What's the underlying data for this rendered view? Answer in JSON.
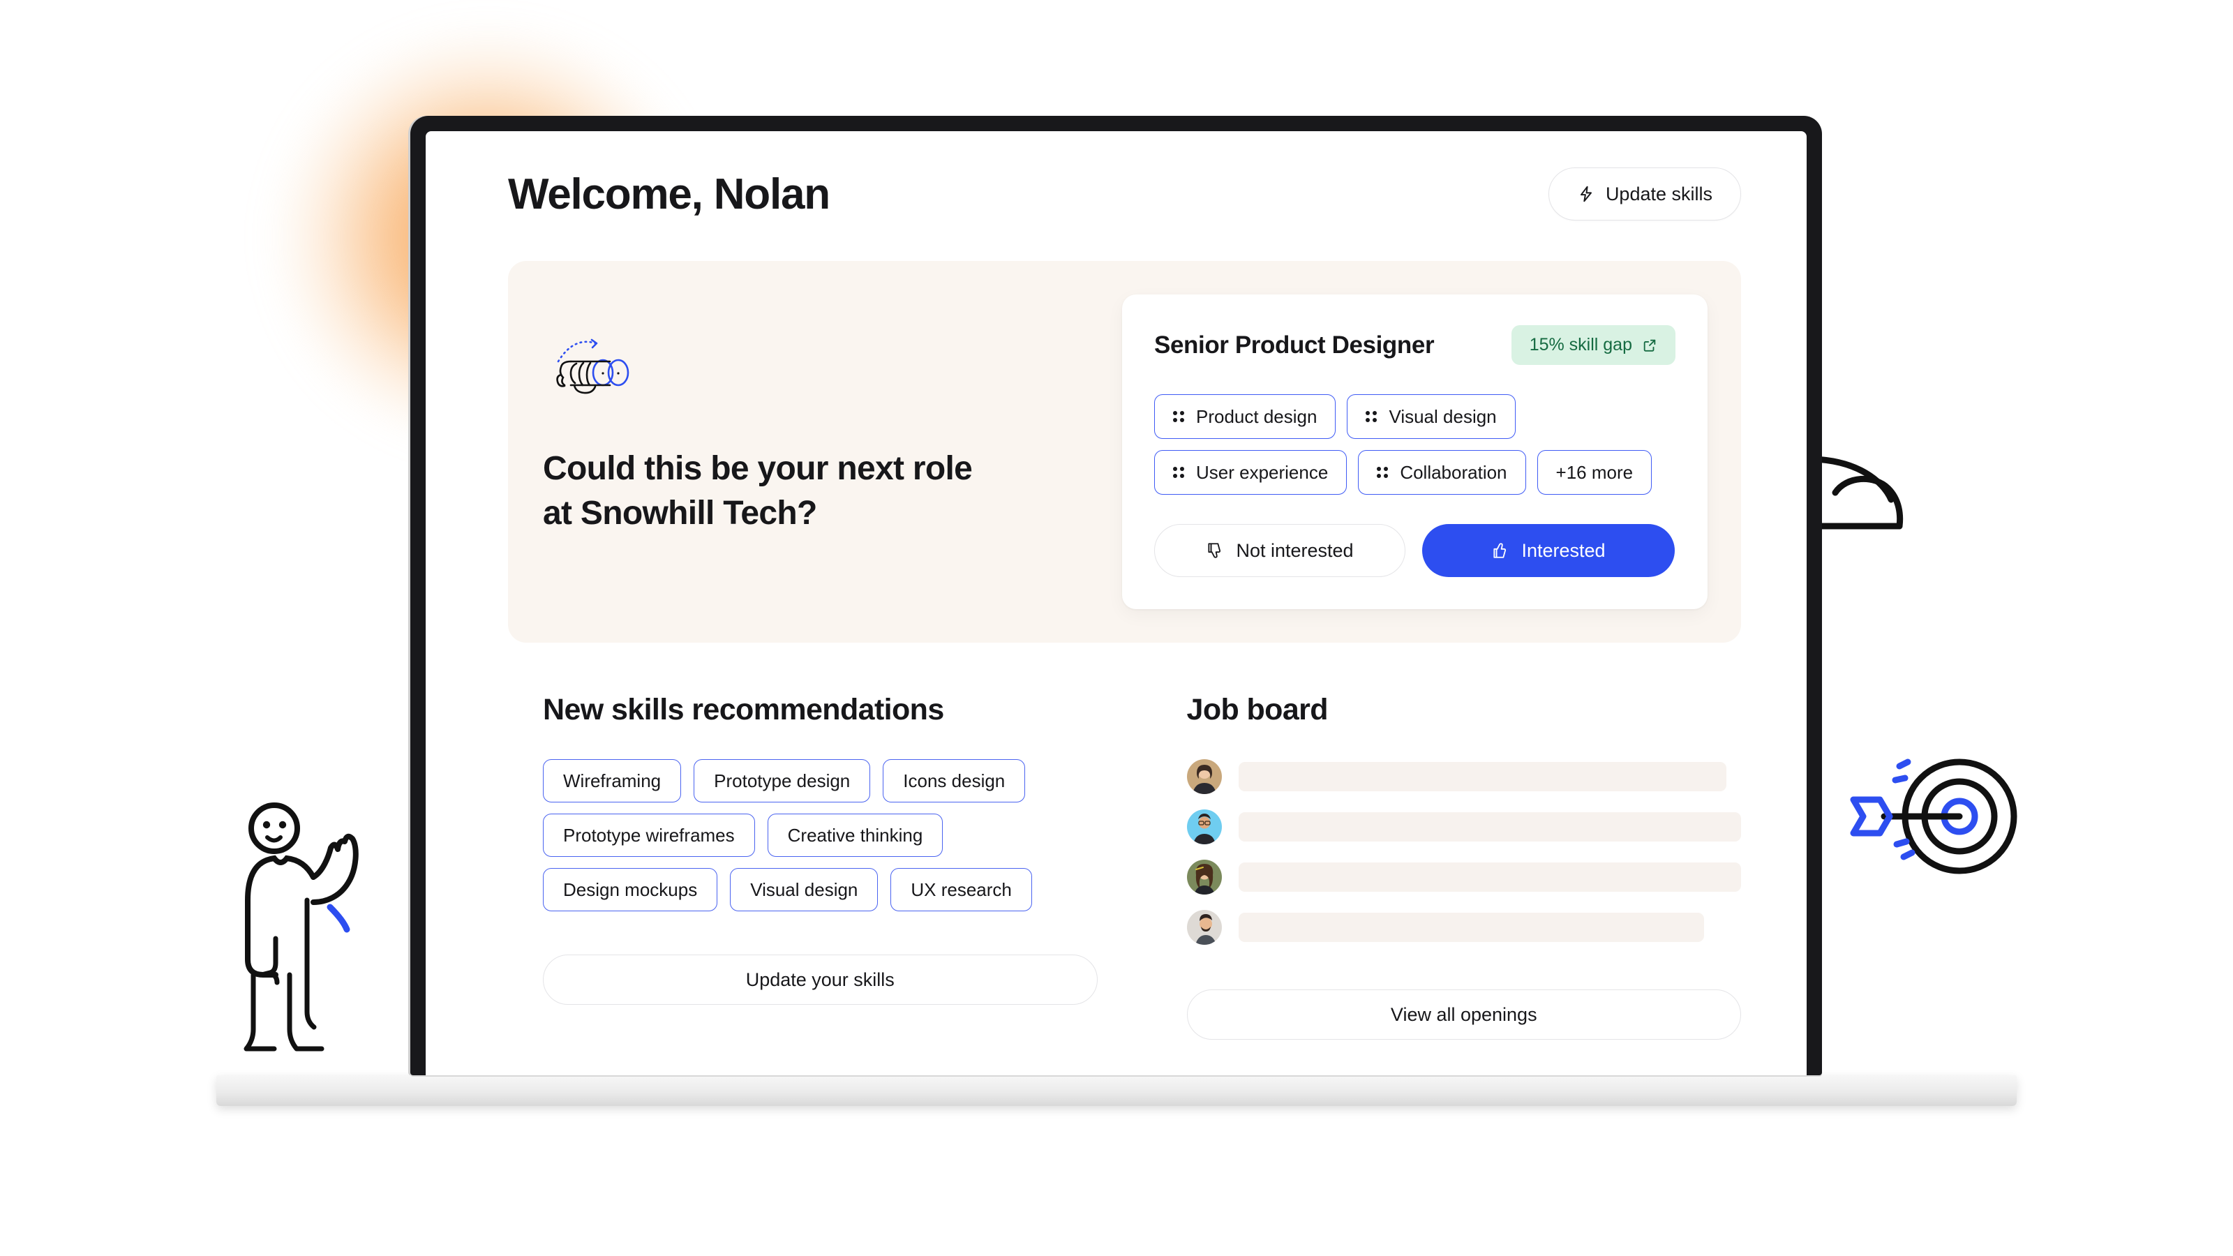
{
  "header": {
    "title": "Welcome, Nolan",
    "update_skills_label": "Update skills",
    "bolt_icon": "lightning-bolt-icon"
  },
  "hero": {
    "illustration": "binoculars-icon",
    "headline_line1": "Could this be your next role",
    "headline_line2": "at Snowhill Tech?",
    "headline": "Could this be your next role at Snowhill Tech?"
  },
  "role_card": {
    "title": "Senior Product Designer",
    "skill_gap_badge": "15% skill gap",
    "external_link_icon": "external-link-icon",
    "chips": [
      {
        "label": "Product design",
        "icon": "dots-grid-icon"
      },
      {
        "label": "Visual design",
        "icon": "dots-grid-icon"
      },
      {
        "label": "User experience",
        "icon": "dots-grid-icon"
      },
      {
        "label": "Collaboration",
        "icon": "dots-grid-icon"
      },
      {
        "label": "+16 more",
        "icon": ""
      }
    ],
    "not_interested_label": "Not interested",
    "interested_label": "Interested",
    "thumbs_down_icon": "thumbs-down-icon",
    "thumbs_up_icon": "thumbs-up-icon"
  },
  "recommendations": {
    "title": "New skills recommendations",
    "chips": [
      "Wireframing",
      "Prototype design",
      "Icons design",
      "Prototype wireframes",
      "Creative thinking",
      "Design mockups",
      "Visual design",
      "UX research"
    ],
    "cta_label": "Update your skills"
  },
  "job_board": {
    "title": "Job board",
    "rows": [
      {
        "avatar_color": "#c9a87c",
        "skeleton_width": "88%"
      },
      {
        "avatar_color": "#6fcdf0",
        "skeleton_width": "96%"
      },
      {
        "avatar_color": "#7b8a5c",
        "skeleton_width": "92%"
      },
      {
        "avatar_color": "#d9d4cf",
        "skeleton_width": "84%"
      }
    ],
    "cta_label": "View all openings"
  },
  "decorations": {
    "person_icon": "waving-person-icon",
    "target_icon": "target-arrow-icon",
    "cloud_icon": "cloud-icon",
    "glow": "orange-radial-glow"
  },
  "colors": {
    "accent_blue": "#2d4ef0",
    "chip_border_blue": "#3f5bf5",
    "badge_green_bg": "#d9f2e3",
    "badge_green_text": "#166b42",
    "hero_card_bg": "#faf5f0",
    "skeleton_bg": "#f7f2ee",
    "text_primary": "#17171a",
    "glow_orange": "#f68b28"
  }
}
